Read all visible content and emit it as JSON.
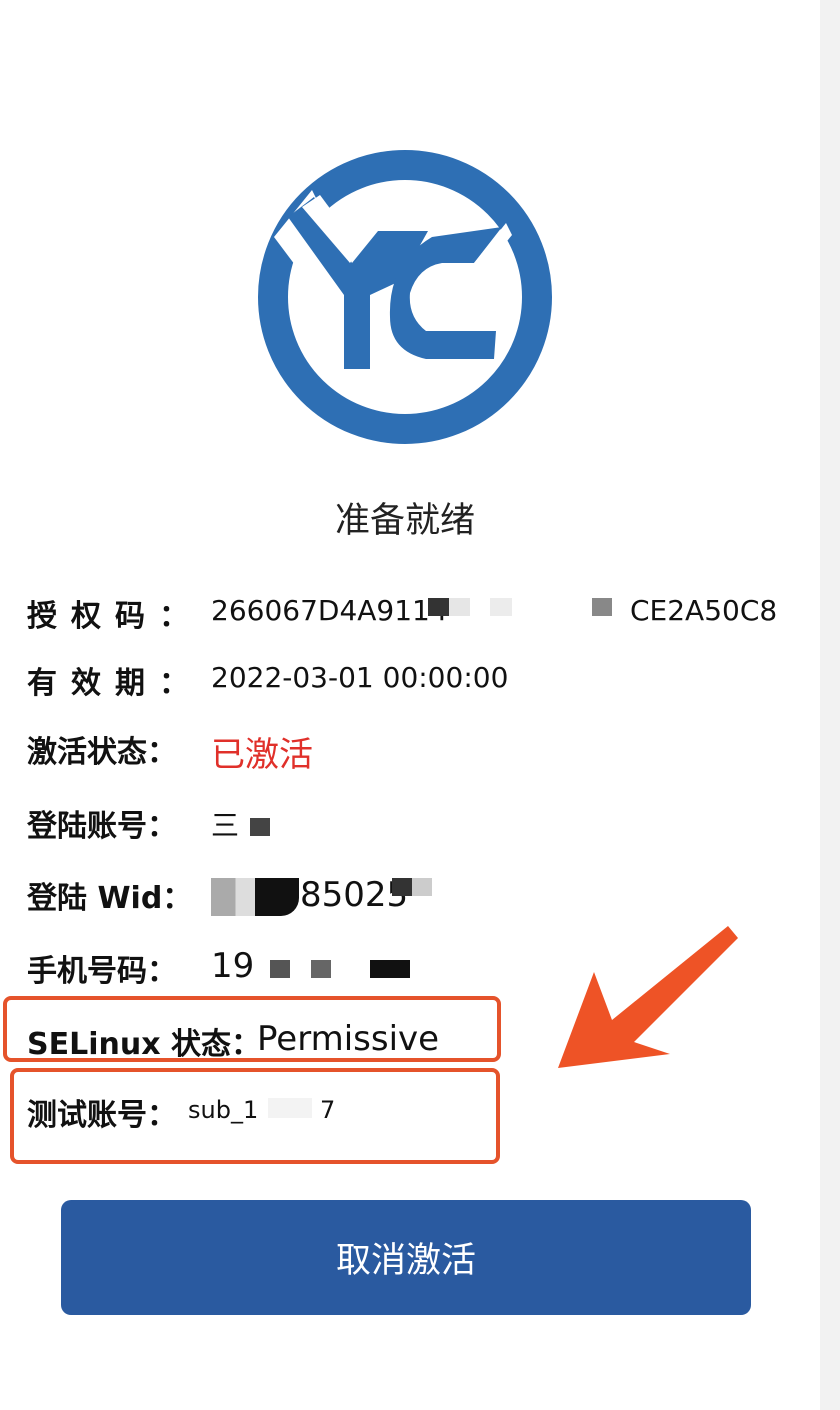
{
  "status": "准备就绪",
  "info": {
    "license": {
      "label": "授权码",
      "colon": "：",
      "value_start": "266067D4A9114",
      "value_end": "CE2A50C8"
    },
    "expiry": {
      "label": "有效期",
      "colon": "：",
      "value": "2022-03-01 00:00:00"
    },
    "activation": {
      "label": "激活状态：",
      "value": "已激活"
    },
    "account": {
      "label": "登陆账号：",
      "value": "三"
    },
    "wid": {
      "label": "登陆 Wid：",
      "value": "85025"
    },
    "phone": {
      "label": "手机号码：",
      "value": "19"
    },
    "selinux": {
      "label": "SELinux 状态：",
      "value": "Permissive"
    },
    "test_account": {
      "label": "测试账号：",
      "value_start": "sub_1",
      "value_end": "7"
    }
  },
  "deactivate_button": "取消激活",
  "colors": {
    "brand_blue": "#2e6fb4",
    "button_blue": "#2a5aa0",
    "active_red": "#e0302a",
    "highlight_orange": "#e5532b"
  }
}
